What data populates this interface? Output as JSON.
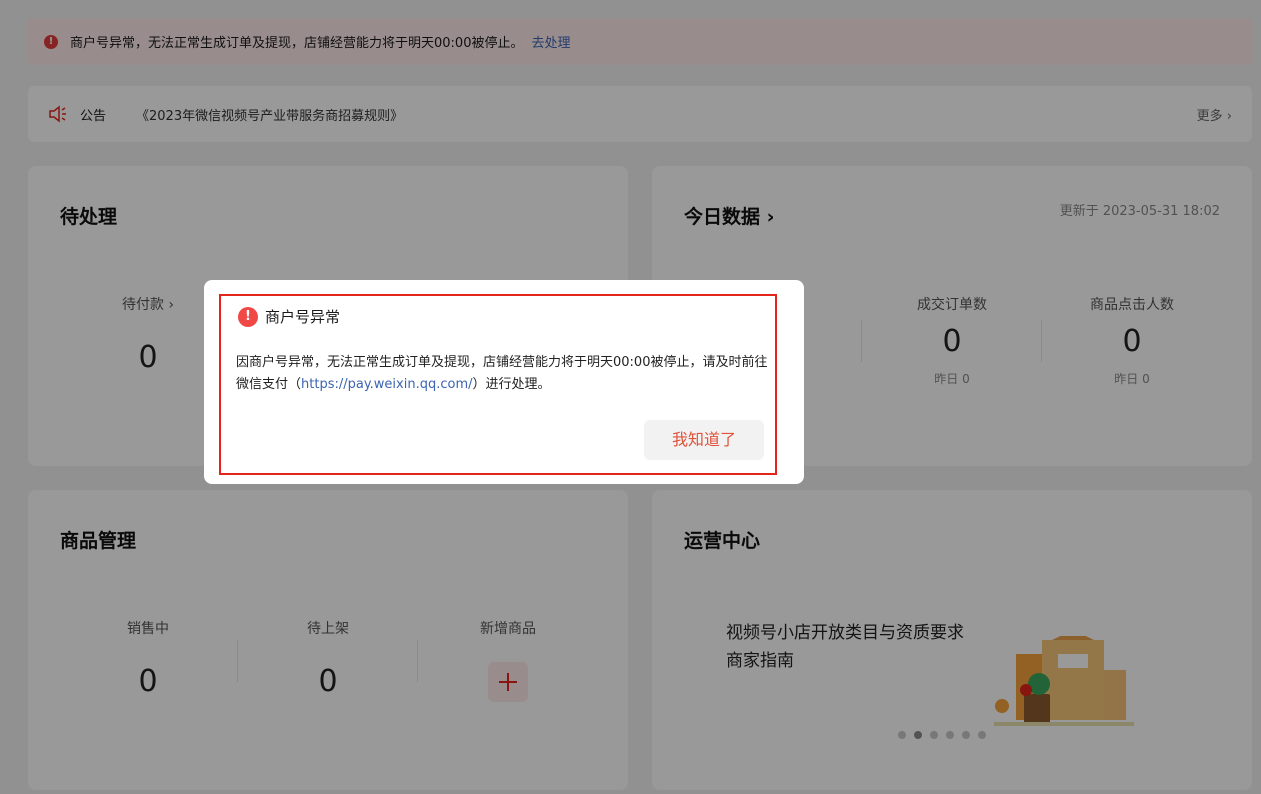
{
  "alert": {
    "message": "商户号异常，无法正常生成订单及提现，店铺经营能力将于明天00:00被停止。",
    "action": "去处理"
  },
  "notice": {
    "label": "公告",
    "text": "《2023年微信视频号产业带服务商招募规则》",
    "more": "更多 ›"
  },
  "pending": {
    "title": "待处理",
    "item_label": "待付款 ›",
    "item_value": "0"
  },
  "today": {
    "title": "今日数据 ›",
    "updated": "更新于 2023-05-31 18:02",
    "metrics": [
      {
        "label": "成交订单数",
        "value": "0",
        "yesterday": "昨日 0"
      },
      {
        "label": "商品点击人数",
        "value": "0",
        "yesterday": "昨日 0"
      }
    ]
  },
  "goods": {
    "title": "商品管理",
    "on_sale_label": "销售中",
    "on_sale_value": "0",
    "pending_label": "待上架",
    "pending_value": "0",
    "add_label": "新增商品"
  },
  "ops": {
    "title": "运营中心",
    "line1": "视频号小店开放类目与资质要求",
    "line2": "商家指南",
    "carousel_count": 6,
    "carousel_active": 2
  },
  "modal": {
    "title": "商户号异常",
    "body_before": "因商户号异常，无法正常生成订单及提现，店铺经营能力将于明天00:00被停止，请及时前往微信支付（",
    "url": "https://pay.weixin.qq.com/",
    "body_after": "）进行处理。",
    "confirm": "我知道了"
  },
  "colors": {
    "accent": "#e4231b",
    "link": "#3c64b1",
    "alert_bg": "#fdecea"
  }
}
